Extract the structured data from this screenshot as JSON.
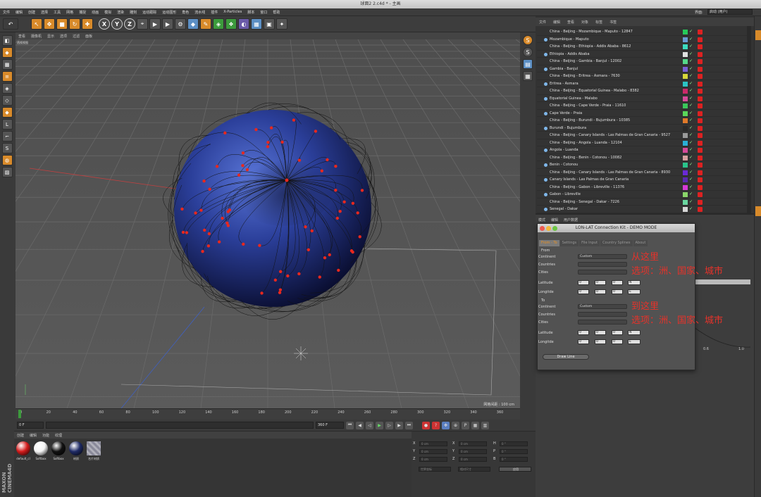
{
  "window": {
    "title": "球面2 2.c4d * - 主画"
  },
  "menubar": [
    "文件",
    "编辑",
    "创建",
    "选择",
    "工具",
    "网格",
    "捕捉",
    "动画",
    "模拟",
    "渲染",
    "雕刻",
    "运动跟踪",
    "运动图形",
    "角色",
    "流水线",
    "插件",
    "X-Particles",
    "脚本",
    "窗口",
    "帮助"
  ],
  "layout": {
    "label": "界面:",
    "value": "启动 (用户)"
  },
  "viewport": {
    "menu": [
      "查看",
      "摄像机",
      "显示",
      "选项",
      "过滤",
      "面板"
    ],
    "label": "透视视图",
    "grid_info": "网格间距 : 100 cm"
  },
  "timeline": {
    "ticks": [
      "0",
      "20",
      "40",
      "60",
      "80",
      "100",
      "120",
      "140",
      "160",
      "180",
      "200",
      "220",
      "240",
      "260",
      "280",
      "300",
      "320",
      "340",
      "360"
    ],
    "end_label": "0 F"
  },
  "transport": {
    "start": "0 F",
    "current": "0 F",
    "end": "360 F",
    "max": "360 F"
  },
  "materials": {
    "menu": [
      "创建",
      "编辑",
      "功能",
      "纹理"
    ],
    "items": [
      {
        "name": "default_cl",
        "color": "#d41c1c"
      },
      {
        "name": "Softbox",
        "color": "#f4f4f4"
      },
      {
        "name": "Softbox",
        "color": "#111111"
      },
      {
        "name": "材质",
        "color": "#1f2b66"
      },
      {
        "name": "名片材质",
        "color": "#9a9aa4"
      }
    ]
  },
  "coords": {
    "rows": [
      {
        "a": "X",
        "av": "0 cm",
        "b": "X",
        "bv": "0 cm",
        "c": "H",
        "cv": "0 °"
      },
      {
        "a": "Y",
        "av": "0 cm",
        "b": "Y",
        "bv": "0 cm",
        "c": "P",
        "cv": "0 °"
      },
      {
        "a": "Z",
        "av": "0 cm",
        "b": "Z",
        "bv": "0 cm",
        "c": "B",
        "cv": "0 °"
      }
    ],
    "sel1": "世界坐标",
    "sel2": "相对尺寸",
    "apply": "应用"
  },
  "objects": {
    "menu": [
      "文件",
      "编辑",
      "查看",
      "对象",
      "标签",
      "书签"
    ],
    "rows": [
      {
        "name": "China - Beijing - Mozambique - Maputo - 12847",
        "dot": false,
        "sw": "#27c95a"
      },
      {
        "name": "Mozambique - Maputo",
        "dot": true,
        "sw": "#6a9ad4"
      },
      {
        "name": "China - Beijing - Ethiopia - Addis Ababa - 8612",
        "dot": false,
        "sw": "#3bdcc0"
      },
      {
        "name": "Ethiopia - Addis Ababa",
        "dot": true,
        "sw": "#e0e0e0"
      },
      {
        "name": "China - Beijing - Gambia - Banjul - 12002",
        "dot": false,
        "sw": "#55d88a"
      },
      {
        "name": "Gambia - Banjul",
        "dot": true,
        "sw": "#7a5fd6"
      },
      {
        "name": "China - Beijing - Eritrea - Asmara - 7630",
        "dot": false,
        "sw": "#d6d63a"
      },
      {
        "name": "Eritrea - Asmara",
        "dot": true,
        "sw": "#2bc4c4"
      },
      {
        "name": "China - Beijing - Equatorial Guinea - Malabo - 8382",
        "dot": false,
        "sw": "#cc2a6a"
      },
      {
        "name": "Equatorial Guinea - Malabo",
        "dot": true,
        "sw": "#d64a9a"
      },
      {
        "name": "China - Beijing - Cape Verde - Praia - 11610",
        "dot": false,
        "sw": "#3ac65a"
      },
      {
        "name": "Cape Verde - Praia",
        "dot": true,
        "sw": "#5ad65a"
      },
      {
        "name": "China - Beijing - Burundi - Bujumbura - 10385",
        "dot": false,
        "sw": "#e07a2a"
      },
      {
        "name": "Burundi - Bujumbura",
        "dot": true,
        "sw": "#2a2a2a"
      },
      {
        "name": "China - Beijing - Canary Islands - Las Palmas de Gran Canaria - 9527",
        "dot": false,
        "sw": "#9a9a9a"
      },
      {
        "name": "China - Beijing - Angola - Luanda - 12104",
        "dot": false,
        "sw": "#2ab0d6"
      },
      {
        "name": "Angola - Luanda",
        "dot": true,
        "sw": "#d64a9a"
      },
      {
        "name": "China - Beijing - Benin - Cotonou - 10082",
        "dot": false,
        "sw": "#d6a0a0"
      },
      {
        "name": "Benin - Cotonou",
        "dot": true,
        "sw": "#2ac48a"
      },
      {
        "name": "China - Beijing - Canary Islands - Las Palmas de Gran Canaria - 8930",
        "dot": false,
        "sw": "#6a2ad6"
      },
      {
        "name": "Canary Islands - Las Palmas de Gran Canaria",
        "dot": true,
        "sw": "#5a2ab0"
      },
      {
        "name": "China - Beijing - Gabon - Libreville - 11376",
        "dot": false,
        "sw": "#d63ad6"
      },
      {
        "name": "Gabon - Libreville",
        "dot": true,
        "sw": "#8ad66a"
      },
      {
        "name": "China - Beijing - Senegal - Dakar - 7226",
        "dot": false,
        "sw": "#6ad6a0"
      },
      {
        "name": "Senegal - Dakar",
        "dot": true,
        "sw": "#d6d6d6"
      }
    ]
  },
  "attributes": {
    "menu": [
      "模式",
      "编辑",
      "用户数据"
    ]
  },
  "dialog": {
    "title": "LON-LAT Connection Kit - DEMO MODE",
    "tabs": [
      "From - To",
      "Settings",
      "File Input",
      "Country Splines",
      "About"
    ],
    "from_label": "From",
    "to_label": "To",
    "continent_label": "Continent",
    "countries_label": "Countries",
    "cities_label": "Cities",
    "latitude_label": "Latitude",
    "longitude_label": "Longitde",
    "from_continent": "Custom",
    "to_continent": "Custom",
    "zero": "0",
    "lat_dir": "N",
    "lon_dir": "E",
    "draw_button": "Draw Line"
  },
  "annotations": {
    "from_1": "从这里",
    "from_2": "选项：洲、国家、城市",
    "to_1": "到这里",
    "to_2": "选项：洲、国家、城市"
  },
  "attr_bg": {
    "a": "0.6",
    "b": "1.0"
  }
}
